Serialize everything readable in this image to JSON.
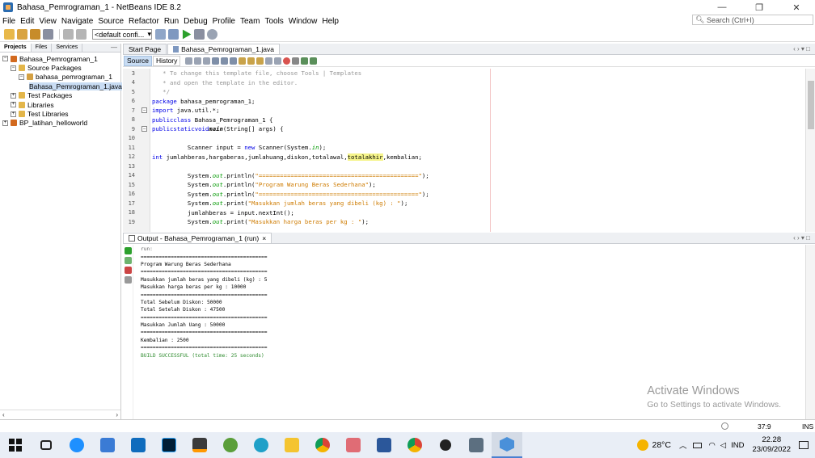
{
  "window": {
    "title": "Bahasa_Pemrograman_1 - NetBeans IDE 8.2",
    "controls": [
      "—",
      "❐",
      "✕"
    ]
  },
  "menu": [
    "File",
    "Edit",
    "View",
    "Navigate",
    "Source",
    "Refactor",
    "Run",
    "Debug",
    "Profile",
    "Team",
    "Tools",
    "Window",
    "Help"
  ],
  "search": {
    "placeholder": "Search (Ctrl+I)"
  },
  "toolbar": {
    "config_value": "<default confi..."
  },
  "projects_panel": {
    "tabs": [
      "Projects",
      "Files",
      "Services"
    ],
    "tree": [
      {
        "label": "Bahasa_Pemrograman_1",
        "indent": 0,
        "expander": "−",
        "icon": "project-icon"
      },
      {
        "label": "Source Packages",
        "indent": 1,
        "expander": "−",
        "icon": "folder-icon"
      },
      {
        "label": "bahasa_pemrograman_1",
        "indent": 2,
        "expander": "−",
        "icon": "package-icon"
      },
      {
        "label": "Bahasa_Pemrograman_1.java",
        "indent": 3,
        "expander": "",
        "icon": "java-file-icon",
        "selected": true
      },
      {
        "label": "Test Packages",
        "indent": 1,
        "expander": "+",
        "icon": "folder-icon"
      },
      {
        "label": "Libraries",
        "indent": 1,
        "expander": "+",
        "icon": "folder-icon"
      },
      {
        "label": "Test Libraries",
        "indent": 1,
        "expander": "+",
        "icon": "folder-icon"
      },
      {
        "label": "BP_latihan_helloworld",
        "indent": 0,
        "expander": "+",
        "icon": "project-icon"
      }
    ]
  },
  "editor": {
    "tabs": [
      "Start Page",
      "Bahasa_Pemrograman_1.java"
    ],
    "source_label": "Source",
    "history_label": "History",
    "line_numbers": [
      "3",
      "4",
      "5",
      "6",
      "7",
      "8",
      "9",
      "10",
      "11",
      "12",
      "13",
      "14",
      "15",
      "16",
      "17",
      "18",
      "19"
    ],
    "code_lines": [
      "   * To change this template file, choose Tools | Templates",
      "   * and open the template in the editor.",
      "   */",
      "  package bahasa_pemrograman_1;",
      "  import java.util.*;",
      "  public class Bahasa_Pemrograman_1 {",
      "      public static void main(String[] args) {",
      "",
      "          Scanner input = new Scanner(System.in);",
      "          int jumlahberas,hargaberas,jumlahuang,diskon,totalawal,totalakhir,kembalian;",
      "",
      "          System.out.println(\"=============================================\");",
      "          System.out.println(\"Program Warung Beras Sederhana\");",
      "          System.out.println(\"=============================================\");",
      "          System.out.print(\"Masukkan jumlah beras yang dibeli (kg) : \");",
      "          jumlahberas = input.nextInt();",
      "          System.out.print(\"Masukkan harga beras per kg : \");"
    ]
  },
  "output": {
    "tab_label": "Output - Bahasa_Pemrograman_1 (run)",
    "lines": [
      "run:",
      "==========================================",
      "Program Warung Beras Sederhana",
      "==========================================",
      "Masukkan jumlah beras yang dibeli (kg) : 5",
      "Masukkan harga beras per kg : 10000",
      "==========================================",
      "Total Sebelum Diskon: 50000",
      "Total Setelah Diskon : 47500",
      "==========================================",
      "Masukkan Jumlah Uang : 50000",
      "==========================================",
      "Kembalian : 2500",
      "==========================================",
      "BUILD SUCCESSFUL (total time: 25 seconds)"
    ]
  },
  "watermark": {
    "line1": "Activate Windows",
    "line2": "Go to Settings to activate Windows."
  },
  "status": {
    "position": "37:9",
    "mode": "INS"
  },
  "taskbar": {
    "temperature": "28°C",
    "language": "IND",
    "time": "22.28",
    "date": "23/09/2022"
  }
}
